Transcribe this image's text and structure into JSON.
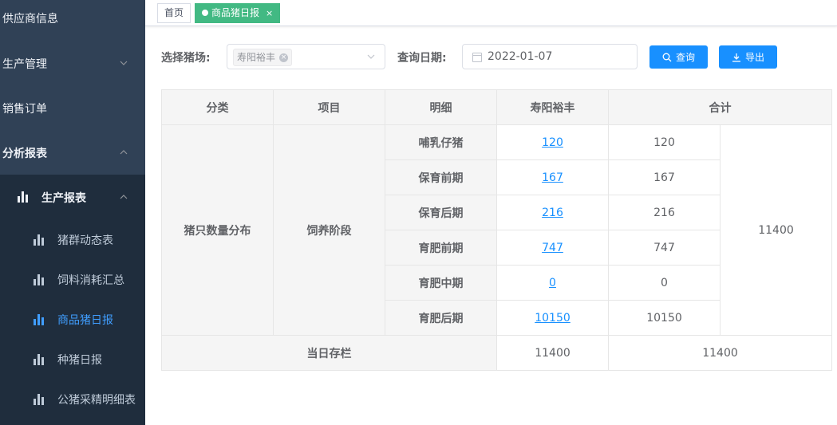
{
  "sidebar": {
    "menu": [
      {
        "label": "供应商信息",
        "chevron": "none"
      },
      {
        "label": "生产管理",
        "chevron": "down"
      },
      {
        "label": "销售订单",
        "chevron": "none"
      },
      {
        "label": "分析报表",
        "chevron": "up"
      }
    ],
    "submenu_head": {
      "label": "生产报表",
      "icon": "bar-chart-icon",
      "chevron": "up"
    },
    "sub_items": [
      {
        "label": "猪群动态表",
        "active": false
      },
      {
        "label": "饲料消耗汇总",
        "active": false
      },
      {
        "label": "商品猪日报",
        "active": true
      },
      {
        "label": "种猪日报",
        "active": false
      },
      {
        "label": "公猪采精明细表",
        "active": false
      }
    ]
  },
  "tags": [
    {
      "label": "首页",
      "active": false
    },
    {
      "label": "商品猪日报",
      "active": true,
      "close": "×"
    }
  ],
  "filters": {
    "farm_label": "选择猪场:",
    "farm_selected": "寿阳裕丰",
    "date_label": "查询日期:",
    "date_value": "2022-01-07",
    "query_button": "查询",
    "export_button": "导出"
  },
  "table": {
    "headers": [
      "分类",
      "项目",
      "明细",
      "寿阳裕丰",
      "合计"
    ],
    "category": "猪只数量分布",
    "item": "饲养阶段",
    "rows": [
      {
        "detail": "哺乳仔猪",
        "farm": "120",
        "total": "120"
      },
      {
        "detail": "保育前期",
        "farm": "167",
        "total": "167"
      },
      {
        "detail": "保育后期",
        "farm": "216",
        "total": "216"
      },
      {
        "detail": "育肥前期",
        "farm": "747",
        "total": "747"
      },
      {
        "detail": "育肥中期",
        "farm": "0",
        "total": "0"
      },
      {
        "detail": "育肥后期",
        "farm": "10150",
        "total": "10150"
      }
    ],
    "grand_total": "11400",
    "footer": {
      "label": "当日存栏",
      "farm": "11400",
      "total": "11400"
    }
  },
  "colors": {
    "sidebar": "#304156",
    "submenu": "#1f2d3d",
    "accent": "#1890ff",
    "active_tag": "#42b983",
    "active_menu": "#409eff"
  }
}
